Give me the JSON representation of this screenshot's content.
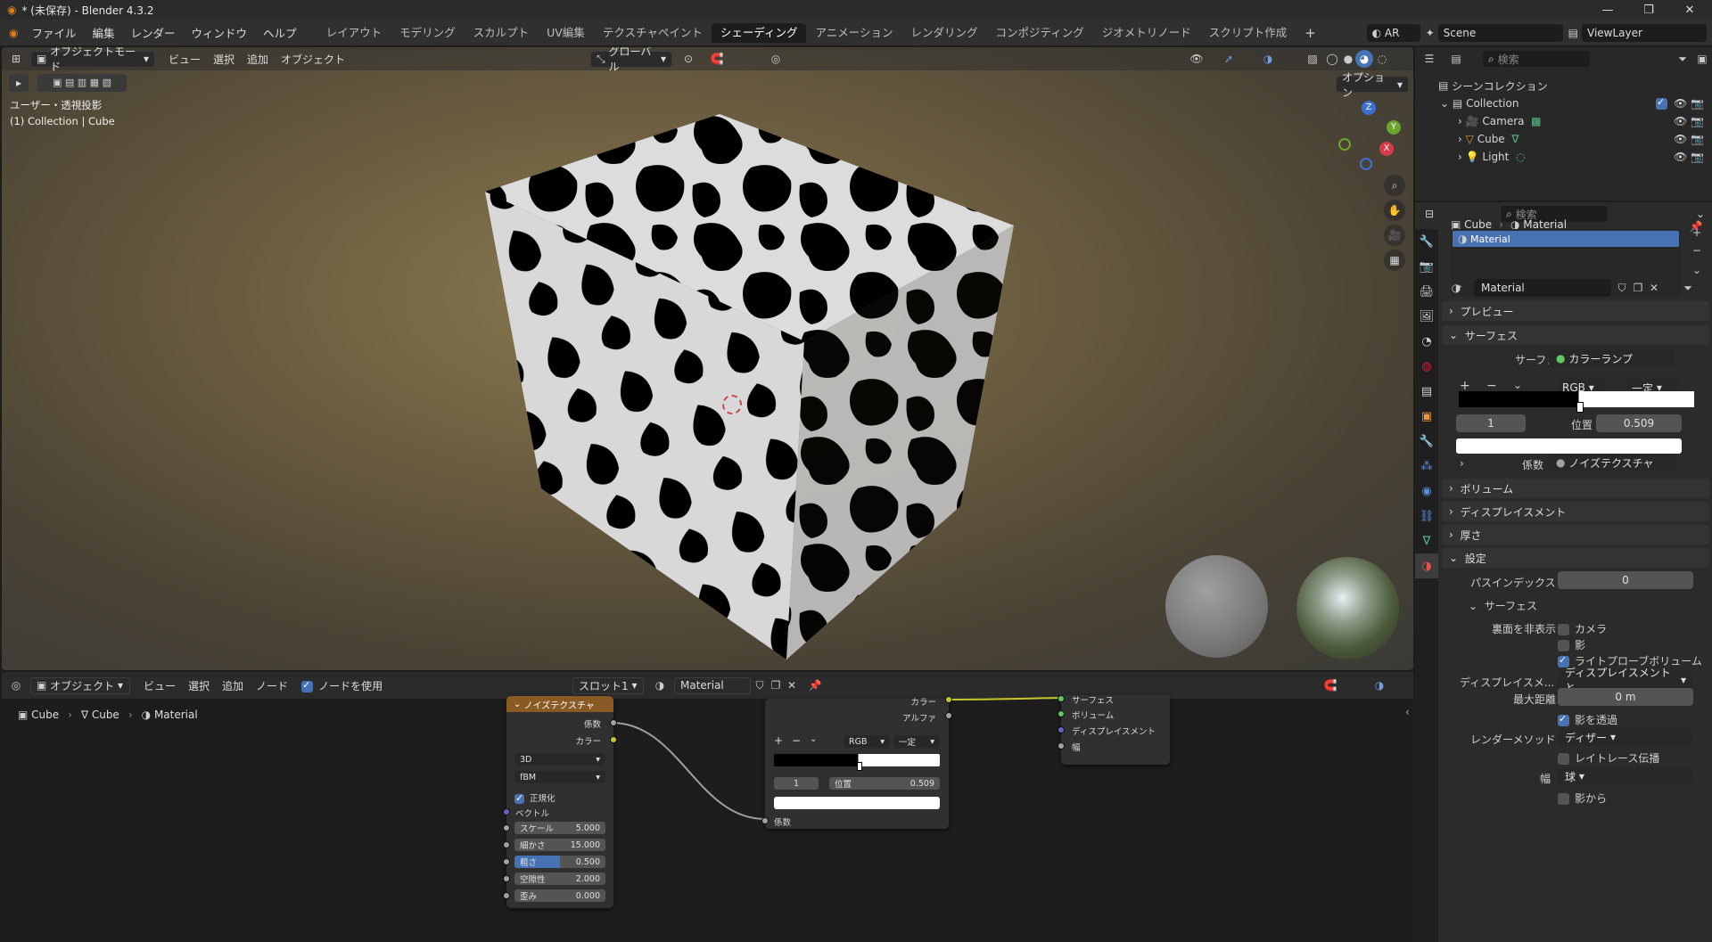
{
  "window": {
    "title": "* (未保存) - Blender 4.3.2"
  },
  "menu": [
    "ファイル",
    "編集",
    "レンダー",
    "ウィンドウ",
    "ヘルプ"
  ],
  "workspaces": [
    "レイアウト",
    "モデリング",
    "スカルプト",
    "UV編集",
    "テクスチャペイント",
    "シェーディング",
    "アニメーション",
    "レンダリング",
    "コンポジティング",
    "ジオメトリノード",
    "スクリプト作成"
  ],
  "topright": {
    "ar": "AR",
    "scene": "Scene",
    "viewlayer": "ViewLayer"
  },
  "viewport": {
    "mode": "オブジェクトモード",
    "menus": [
      "ビュー",
      "選択",
      "追加",
      "オブジェクト"
    ],
    "orientation": "グローバル",
    "options": "オプション",
    "info_line1": "ユーザー・透視投影",
    "info_line2": "(1) Collection | Cube",
    "axes": {
      "x": "X",
      "y": "Y",
      "z": "Z"
    }
  },
  "node_editor": {
    "editor_type": "オブジェクト",
    "menus": [
      "ビュー",
      "選択",
      "追加",
      "ノード"
    ],
    "use_nodes": "ノードを使用",
    "slot": "スロット1",
    "material": "Material",
    "breadcrumb": [
      "Cube",
      "Cube",
      "Material"
    ]
  },
  "noise_node": {
    "title": "ノイズテクスチャ",
    "outputs": [
      "係数",
      "カラー"
    ],
    "dim": "3D",
    "type": "fBM",
    "normalize": "正規化",
    "vector": "ベクトル",
    "inputs": [
      {
        "label": "スケール",
        "value": "5.000"
      },
      {
        "label": "細かさ",
        "value": "15.000"
      },
      {
        "label": "粗さ",
        "value": "0.500"
      },
      {
        "label": "空隙性",
        "value": "2.000"
      },
      {
        "label": "歪み",
        "value": "0.000"
      }
    ]
  },
  "ramp_node": {
    "outputs": [
      "カラー",
      "アルファ"
    ],
    "mode": "RGB",
    "interp": "一定",
    "index": "1",
    "pos_label": "位置",
    "pos": "0.509",
    "input": "係数"
  },
  "output_node": {
    "inputs": [
      "サーフェス",
      "ボリューム",
      "ディスプレイスメント",
      "幅"
    ]
  },
  "outliner": {
    "search": "検索",
    "scene_collection": "シーンコレクション",
    "collection": "Collection",
    "items": [
      "Camera",
      "Cube",
      "Light"
    ]
  },
  "properties": {
    "search": "検索",
    "breadcrumb": [
      "Cube",
      "Material"
    ],
    "slot": "Material",
    "material_name": "Material",
    "sections": {
      "preview": "プレビュー",
      "surface": "サーフェス",
      "volume": "ボリューム",
      "displacement": "ディスプレイスメント",
      "thickness": "厚さ",
      "settings": "設定",
      "surface_sub": "サーフェス"
    },
    "surface_label": "サーフェス",
    "surface_value": "カラーランプ",
    "ramp": {
      "mode": "RGB",
      "interp": "一定",
      "index": "1",
      "pos_label": "位置",
      "pos": "0.509",
      "fac_label": "係数",
      "fac_value": "ノイズテクスチャ"
    },
    "pass_index_label": "パスインデックス",
    "pass_index": "0",
    "backface_label": "裏面を非表示",
    "camera": "カメラ",
    "shadow": "影",
    "lightprobe": "ライトプローブボリューム",
    "disp_label": "ディスプレイスメ...",
    "disp_value": "ディスプレイスメントと...",
    "maxdist_label": "最大距離",
    "maxdist": "0 m",
    "transparent_shadow": "影を透過",
    "render_method_label": "レンダーメソッド",
    "render_method": "ディザー",
    "raytrace": "レイトレース伝播",
    "thickness_label": "幅",
    "thickness_value": "球",
    "from_shadow": "影から"
  }
}
